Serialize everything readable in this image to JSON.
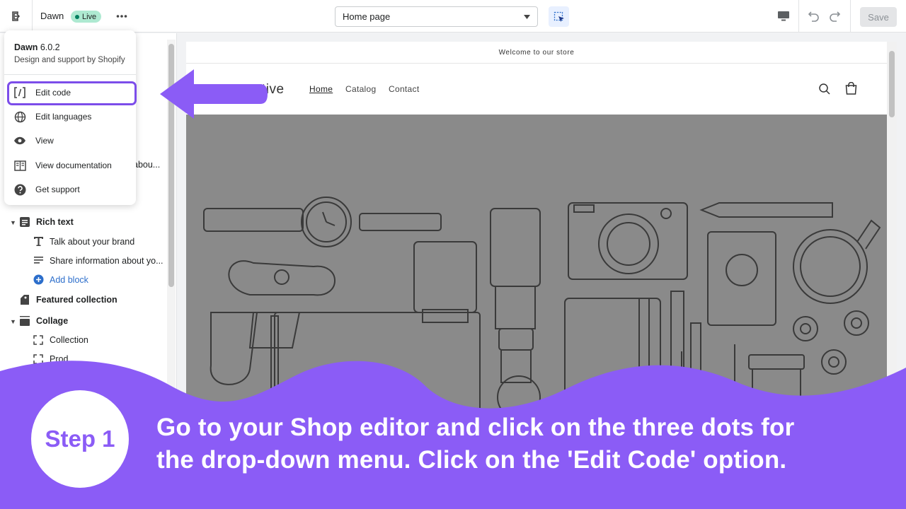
{
  "topbar": {
    "theme_name": "Dawn",
    "live_badge": "Live",
    "page_select": "Home page",
    "save_label": "Save"
  },
  "dropdown": {
    "theme_name": "Dawn",
    "theme_version": "6.0.2",
    "subtitle": "Design and support by Shopify",
    "items": [
      {
        "label": "Edit code",
        "icon": "code-icon"
      },
      {
        "label": "Edit languages",
        "icon": "globe-icon"
      },
      {
        "label": "View",
        "icon": "eye-icon"
      },
      {
        "label": "View documentation",
        "icon": "book-icon"
      },
      {
        "label": "Get support",
        "icon": "question-icon"
      }
    ]
  },
  "sidebar": {
    "partial_text": "abou...",
    "items": [
      {
        "label": "Rich text",
        "icon": "text-block-icon"
      },
      {
        "label": "Talk about your brand",
        "icon": "heading-t-icon"
      },
      {
        "label": "Share information about yo...",
        "icon": "text-lines-icon"
      },
      {
        "label": "Add block",
        "icon": "plus-circle-icon"
      },
      {
        "label": "Featured collection",
        "icon": "tag-icon"
      },
      {
        "label": "Collage",
        "icon": "collage-icon"
      },
      {
        "label": "Collection",
        "icon": "corners-icon"
      },
      {
        "label": "Prod...",
        "icon": "corners-icon"
      }
    ]
  },
  "preview": {
    "announcement": "Welcome to our store",
    "logo_text": "tive",
    "nav": [
      "Home",
      "Catalog",
      "Contact"
    ]
  },
  "overlay": {
    "step_label": "Step 1",
    "instruction": "Go to your Shop editor and click on the three dots for\nthe drop-down menu. Click on the 'Edit Code' option."
  },
  "colors": {
    "accent_purple": "#8b5cf6",
    "highlight_border": "#7c4dea",
    "live_badge_bg": "#aee9d1",
    "link_blue": "#2c6ecb"
  }
}
